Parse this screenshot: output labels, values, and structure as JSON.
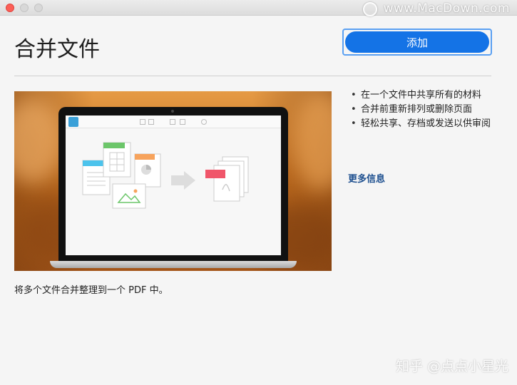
{
  "watermark": {
    "top_text": "www.MacDown.com",
    "bottom_text": "知乎 @点点小星光"
  },
  "page": {
    "title": "合并文件",
    "add_button_label": "添加",
    "description": "将多个文件合并整理到一个 PDF 中。"
  },
  "features": {
    "items": [
      {
        "text": "在一个文件中共享所有的材料"
      },
      {
        "text": "合并前重新排列或删除页面"
      },
      {
        "text": "轻松共享、存档或发送以供审阅"
      }
    ],
    "more_info_label": "更多信息"
  },
  "colors": {
    "accent": "#1473e6",
    "link": "#1d4f8f",
    "traffic_close": "#fc5f57",
    "hero_orange": "#d9822b"
  },
  "icons": {
    "app_logo": "acrobat-logo-icon",
    "arrow": "right-arrow-icon",
    "pdf": "pdf-icon"
  }
}
